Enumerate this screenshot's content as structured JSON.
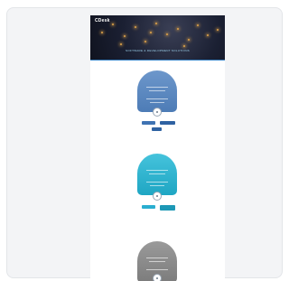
{
  "preview": {
    "brand": "CDesk",
    "banner_caption": "SOFTWARE & DEVELOPMENT SOLUTIONS"
  },
  "tiers": [
    {
      "name": "tier-blue",
      "color": "#5b88c0",
      "accent": "#2f6aad"
    },
    {
      "name": "tier-teal",
      "color": "#2cb4cf",
      "accent": "#1d98b6"
    },
    {
      "name": "tier-gray",
      "color": "#8a8a8a",
      "accent": "#666666"
    }
  ],
  "colors": {
    "card_bg": "#f3f4f6",
    "banner_dark": "#1b2033",
    "spark": "#e0a44a"
  }
}
